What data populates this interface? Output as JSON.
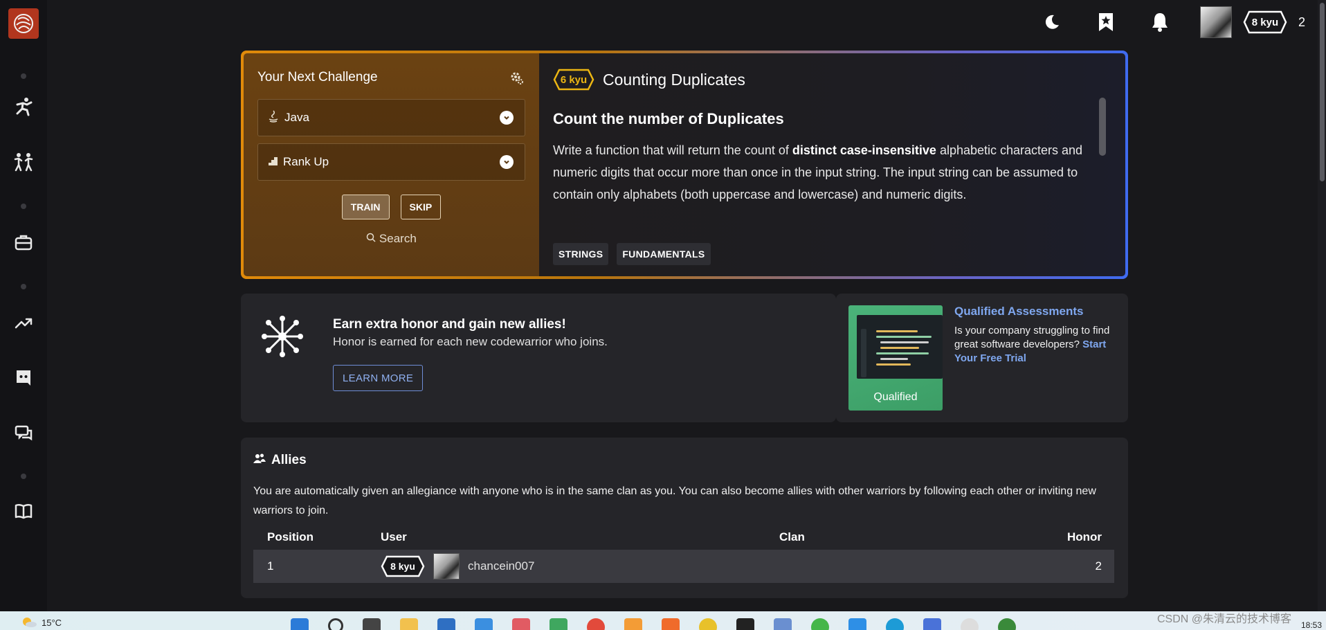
{
  "topbar": {
    "rank_badge": "8 kyu",
    "honor": "2"
  },
  "challenge": {
    "title": "Your Next Challenge",
    "language": "Java",
    "strategy": "Rank Up",
    "train_label": "TRAIN",
    "skip_label": "SKIP",
    "search_label": "Search",
    "kata": {
      "rank": "6 kyu",
      "rank_color": "#ecb613",
      "name": "Counting Duplicates",
      "subtitle": "Count the number of Duplicates",
      "desc_before": "Write a function that will return the count of ",
      "desc_bold": "distinct case-insensitive",
      "desc_after": " alphabetic characters and numeric digits that occur more than once in the input string. The input string can be assumed to contain only alphabets (both uppercase and lowercase) and numeric digits.",
      "tags": [
        "STRINGS",
        "FUNDAMENTALS"
      ]
    }
  },
  "honor_card": {
    "title": "Earn extra honor and gain new allies!",
    "subtitle": "Honor is earned for each new codewarrior who joins.",
    "button": "LEARN MORE"
  },
  "qualified": {
    "image_label": "Qualified",
    "title": "Qualified Assessments",
    "text": "Is your company struggling to find great software developers? ",
    "cta": "Start Your Free Trial"
  },
  "allies": {
    "title": "Allies",
    "description": "You are automatically given an allegiance with anyone who is in the same clan as you. You can also become allies with other warriors by following each other or inviting new warriors to join.",
    "columns": [
      "Position",
      "User",
      "Clan",
      "Honor"
    ],
    "rows": [
      {
        "position": "1",
        "rank": "8 kyu",
        "user": "chancein007",
        "clan": "",
        "honor": "2"
      }
    ]
  },
  "taskbar": {
    "temperature": "15°C",
    "time": "18:53",
    "watermark": "CSDN @朱清云的技术博客"
  },
  "colors": {
    "brand": "#b1361e",
    "accent_blue": "#7fa7ef",
    "kyu_gold": "#ecb613"
  }
}
